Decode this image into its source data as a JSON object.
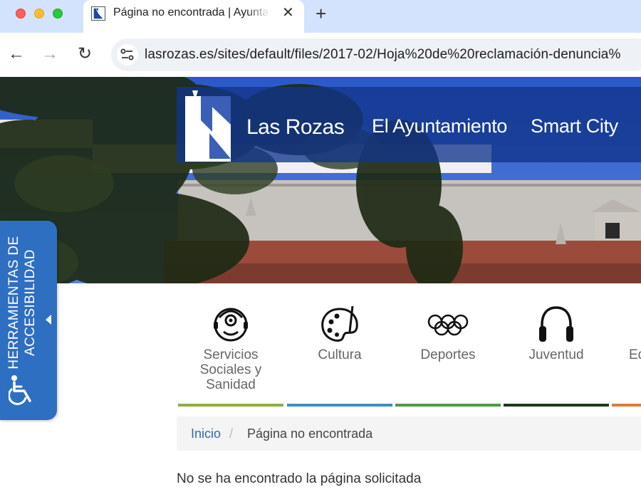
{
  "browser": {
    "tab_title": "Página no encontrada | Ayuntamiento de Las Rozas",
    "close_glyph": "✕",
    "new_tab_glyph": "+",
    "back_glyph": "←",
    "forward_glyph": "→",
    "reload_glyph": "↻",
    "url": "lasrozas.es/sites/default/files/2017-02/Hoja%20de%20reclamación-denuncia%"
  },
  "header": {
    "brand": "Las Rozas",
    "menu": [
      {
        "label": "El Ayuntamiento"
      },
      {
        "label": "Smart City"
      }
    ]
  },
  "accessibility": {
    "label": "HERRAMIENTAS DE ACCESIBILIDAD"
  },
  "categories": [
    {
      "label": "Servicios Sociales y Sanidad",
      "icon": "social-services-icon",
      "color": "#8dae3c"
    },
    {
      "label": "Cultura",
      "icon": "palette-icon",
      "color": "#3d8ec9"
    },
    {
      "label": "Deportes",
      "icon": "olympic-rings-icon",
      "color": "#4f9a45"
    },
    {
      "label": "Juventud",
      "icon": "headphones-icon",
      "color": "#1f3a1f"
    },
    {
      "label": "Ed",
      "icon": "",
      "color": "#e07b33"
    }
  ],
  "breadcrumb": {
    "home": "Inicio",
    "separator": "/",
    "current": "Página no encontrada"
  },
  "content": {
    "message": "No se ha encontrado la página solicitada"
  }
}
